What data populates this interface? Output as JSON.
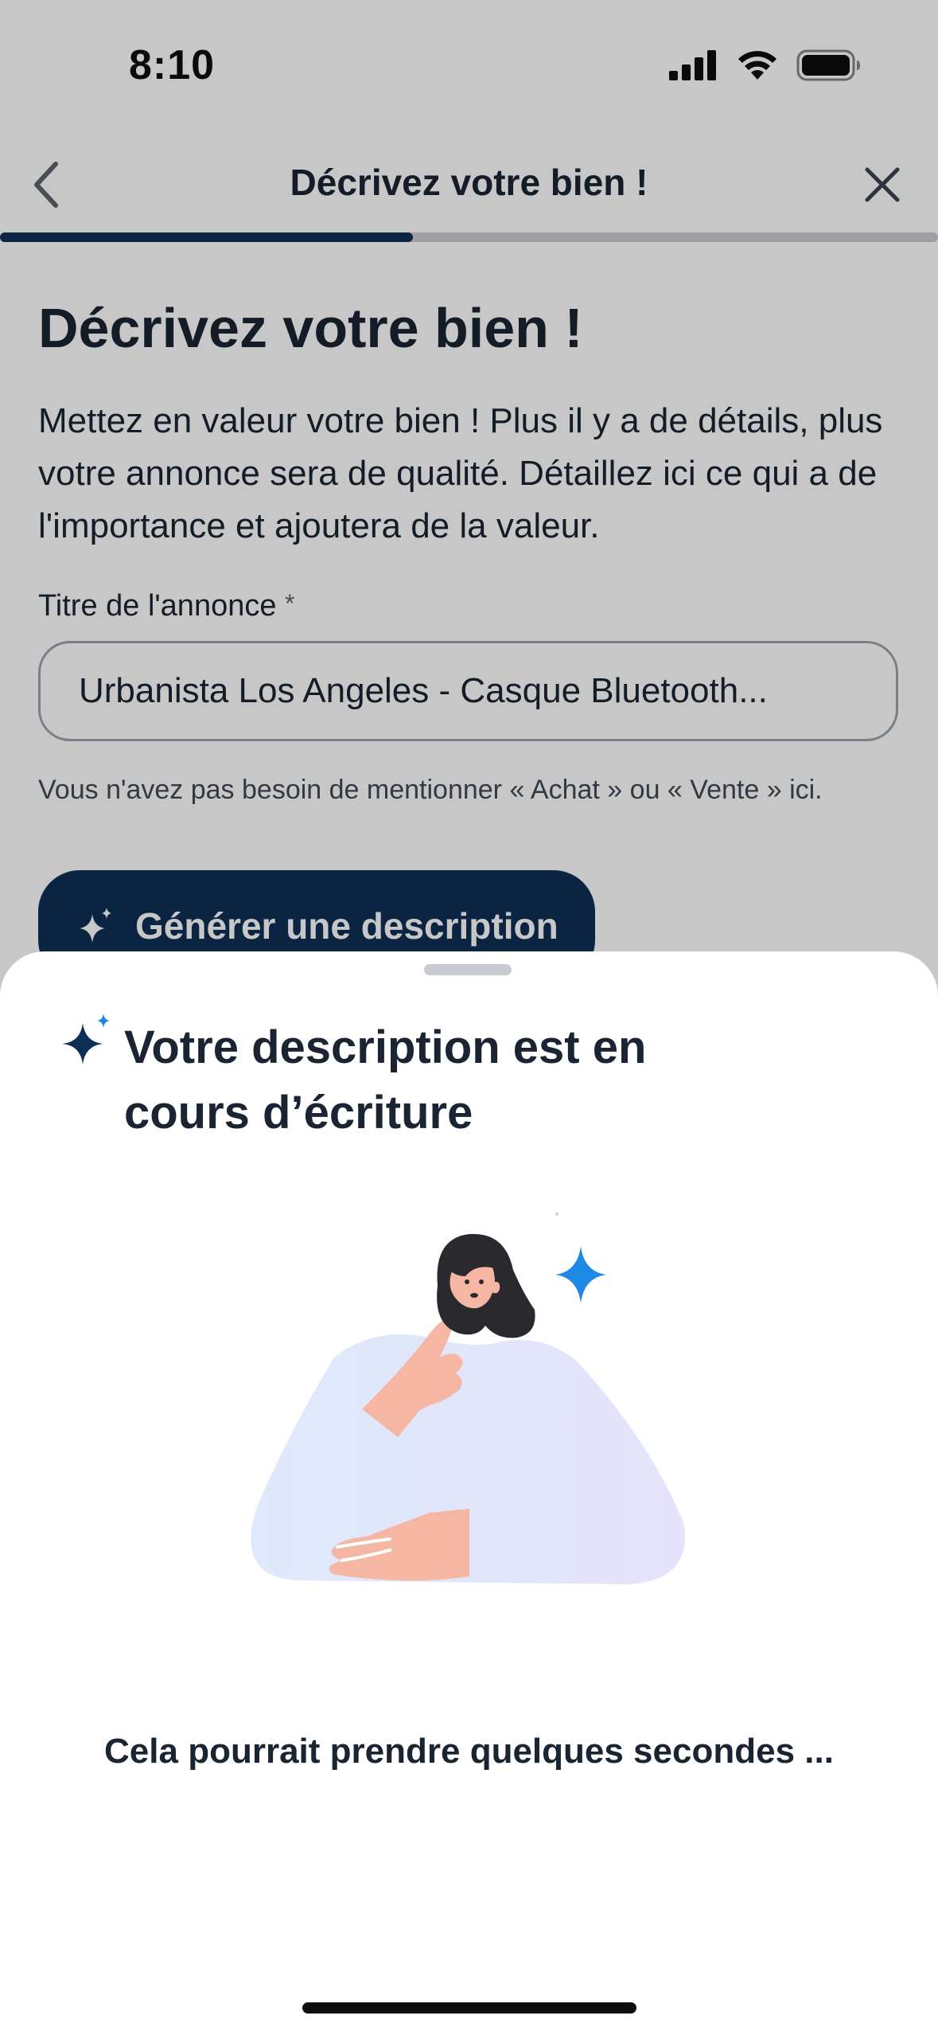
{
  "status_bar": {
    "time": "8:10",
    "icons": [
      "cellular-signal-icon",
      "wifi-icon",
      "battery-icon"
    ]
  },
  "nav": {
    "title": "Décrivez votre bien !",
    "back_icon": "chevron-left-icon",
    "close_icon": "close-icon"
  },
  "progress": {
    "fraction": 0.44,
    "fill_color": "#0e2f55",
    "track_color": "#c9ccd2"
  },
  "main": {
    "heading": "Décrivez votre bien !",
    "intro": "Mettez en valeur votre bien ! Plus il y a de détails, plus votre annonce sera de qualité. Détaillez ici ce qui a de l'importance et ajoutera de la valeur.",
    "title_field": {
      "label": "Titre de l'annonce",
      "required_mark": "*",
      "value": "Urbanista Los Angeles - Casque Bluetooth..."
    },
    "hint": "Vous n'avez pas besoin de mentionner « Achat » ou « Vente » ici.",
    "generate_button": {
      "label": "Générer une description",
      "icon": "sparkle-icon"
    }
  },
  "sheet": {
    "title": "Votre description est en cours d’écriture",
    "title_icon": "sparkle-icon",
    "illustration": "thinking-woman-illustration",
    "message": "Cela pourrait prendre quelques secondes ...",
    "accent_color": "#1e88e5",
    "brand_color": "#0e2f55"
  }
}
